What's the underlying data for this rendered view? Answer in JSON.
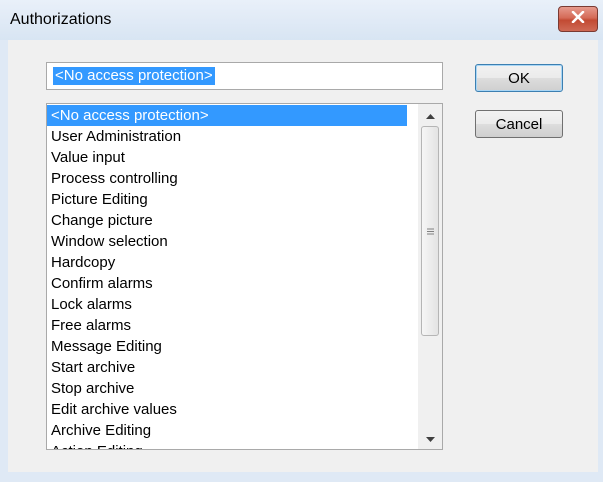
{
  "window": {
    "title": "Authorizations"
  },
  "edit_field": {
    "value": "<No access protection>"
  },
  "buttons": {
    "ok_label": "OK",
    "cancel_label": "Cancel"
  },
  "list": {
    "selected_index": 0,
    "items": [
      "<No access protection>",
      "User Administration",
      "Value input",
      "Process controlling",
      "Picture Editing",
      "Change picture",
      "Window selection",
      "Hardcopy",
      "Confirm alarms",
      "Lock alarms",
      "Free alarms",
      "Message Editing",
      "Start archive",
      "Stop archive",
      "Edit archive values",
      "Archive Editing",
      "Action Editing"
    ]
  },
  "icons": {
    "close": "close-icon",
    "scroll_up": "arrow-up-icon",
    "scroll_down": "arrow-down-icon",
    "thumb_grip": "grip-icon"
  },
  "colors": {
    "selection": "#3399ff",
    "close_button": "#c24a33"
  }
}
